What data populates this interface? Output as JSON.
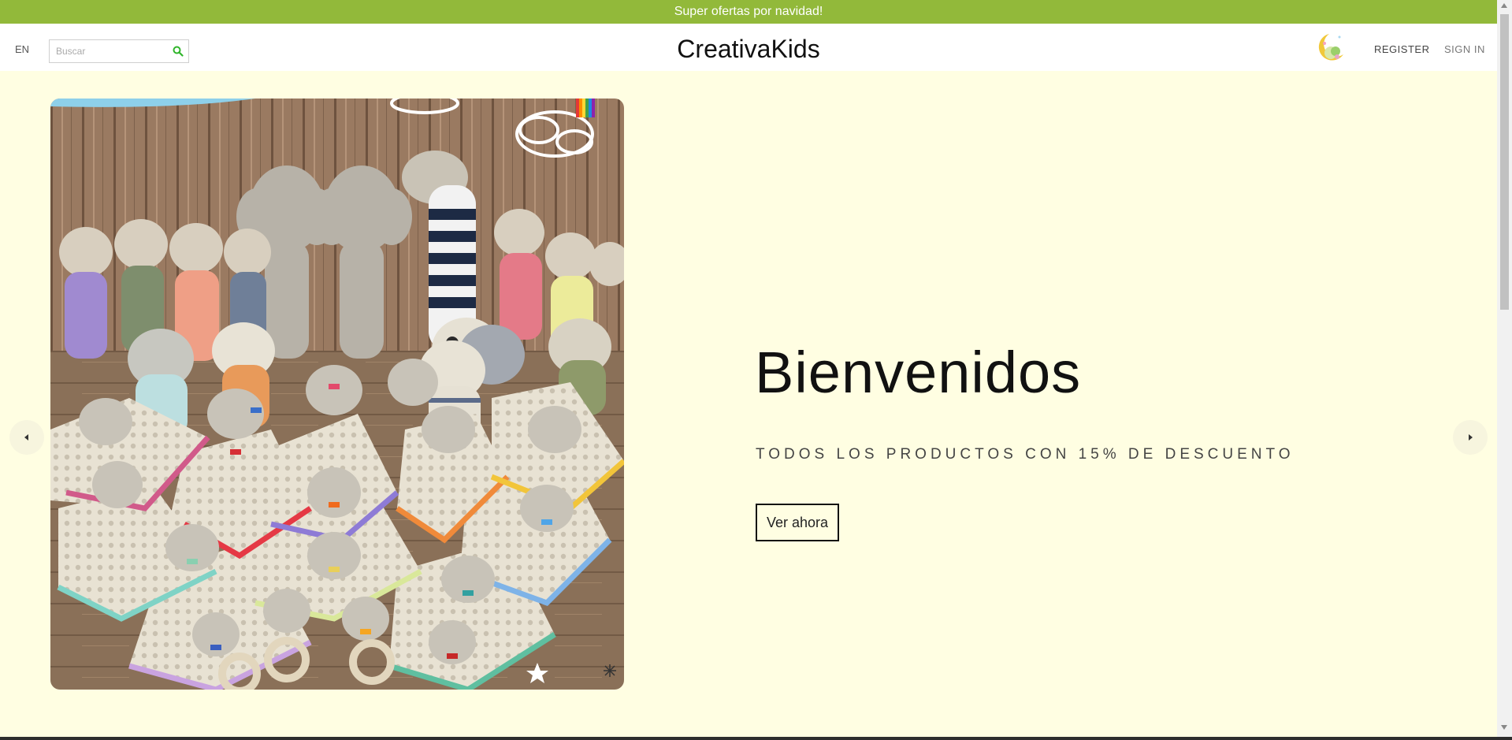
{
  "announcement": {
    "text": "Super ofertas por navidad!"
  },
  "header": {
    "language": "EN",
    "search": {
      "placeholder": "Buscar",
      "value": ""
    },
    "logo": "CreativaKids",
    "nav": {
      "register": "REGISTER",
      "sign_in": "SIGN IN"
    }
  },
  "hero": {
    "title": "Bienvenidos",
    "subtitle": "TODOS LOS PRODUCTOS CON 15% DE DESCUENTO",
    "button": "Ver ahora"
  },
  "colors": {
    "announcement_bg": "#92b93a",
    "hero_bg": "#fffee2",
    "search_icon": "#2fb52a"
  },
  "icons": {
    "search": "search-icon",
    "prev": "chevron-left-icon",
    "next": "chevron-right-icon",
    "avatar": "moon-avatar-icon"
  }
}
